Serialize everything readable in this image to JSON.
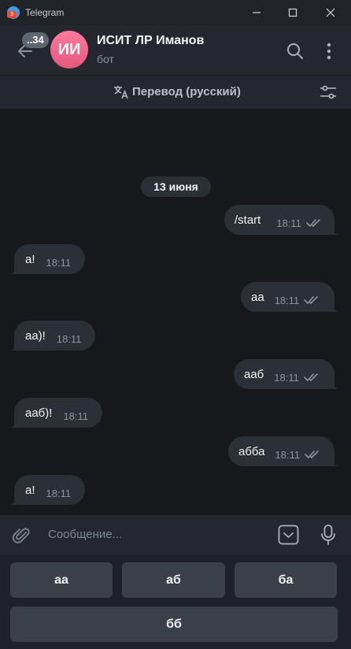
{
  "window": {
    "app_title": "Telegram",
    "app_icon_badge": "3",
    "controls": [
      "minimize-icon",
      "maximize-icon",
      "close-icon"
    ]
  },
  "header": {
    "unread_count": "..34",
    "avatar_initials": "ИИ",
    "chat_name": "ИСИТ ЛР Иманов",
    "chat_status": "бот"
  },
  "translate_bar": {
    "label": "Перевод (русский)"
  },
  "chat": {
    "date": "13 июня",
    "messages": [
      {
        "direction": "out",
        "text": "/start",
        "time": "18:11",
        "read": true
      },
      {
        "direction": "in",
        "text": "а!",
        "time": "18:11"
      },
      {
        "direction": "out",
        "text": "аа",
        "time": "18:11",
        "read": true
      },
      {
        "direction": "in",
        "text": "аа)!",
        "time": "18:11"
      },
      {
        "direction": "out",
        "text": "ааб",
        "time": "18:11",
        "read": true
      },
      {
        "direction": "in",
        "text": "ааб)!",
        "time": "18:11"
      },
      {
        "direction": "out",
        "text": "абба",
        "time": "18:11",
        "read": true
      },
      {
        "direction": "in",
        "text": "а!",
        "time": "18:11"
      }
    ]
  },
  "composer": {
    "placeholder": "Сообщение..."
  },
  "bot_keyboard": {
    "row1": [
      "аа",
      "аб",
      "ба"
    ],
    "row2": [
      "бб"
    ]
  },
  "colors": {
    "chat_background": "#16181c",
    "bubble": "#2b3037",
    "panel": "#24282e",
    "avatar": "#e5577d",
    "key": "#3a4048"
  }
}
